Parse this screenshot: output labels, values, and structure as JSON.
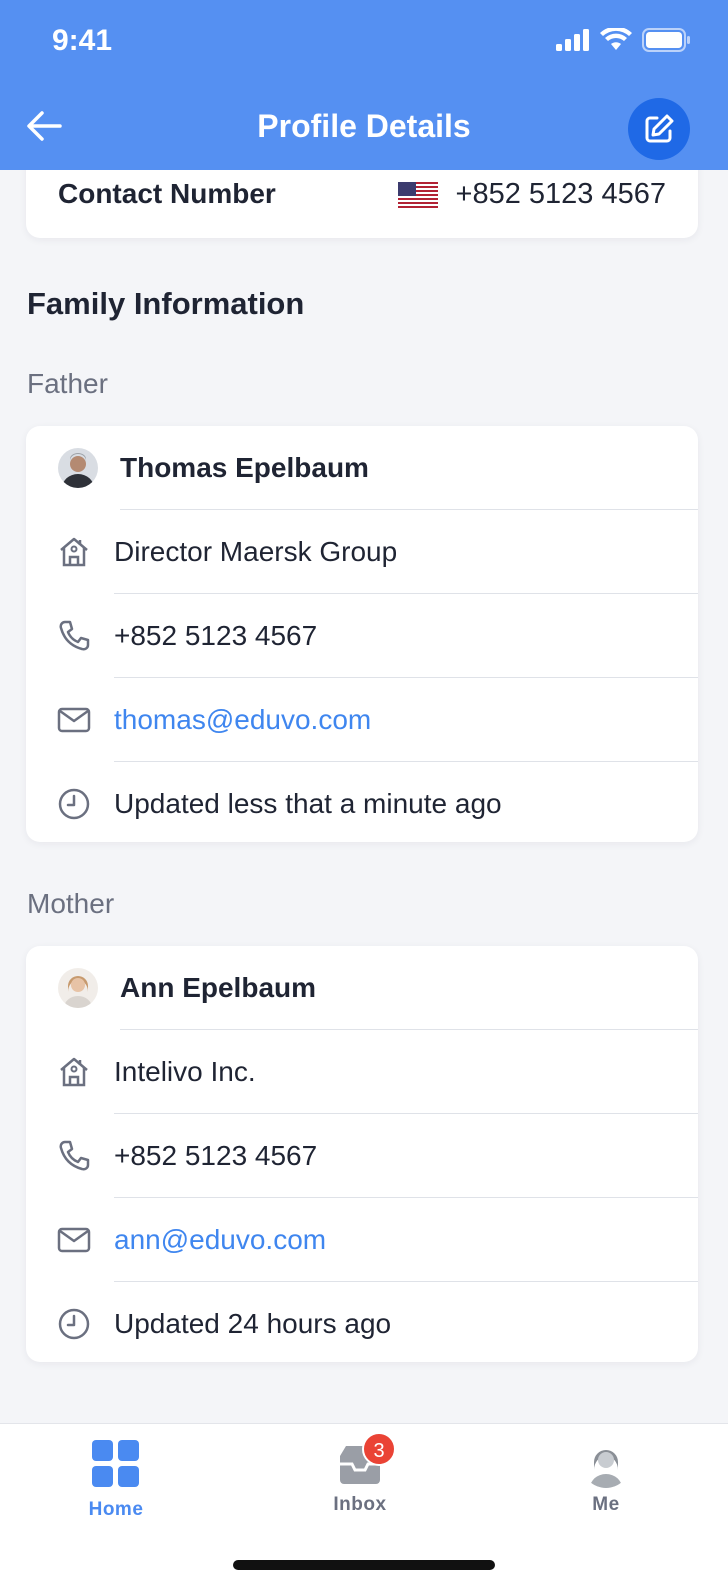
{
  "status": {
    "time": "9:41"
  },
  "header": {
    "title": "Profile Details"
  },
  "contact": {
    "label": "Contact Number",
    "value": "+852 5123 4567"
  },
  "family": {
    "title": "Family Information",
    "father": {
      "label": "Father",
      "name": "Thomas Epelbaum",
      "company": "Director Maersk Group",
      "phone": "+852 5123 4567",
      "email": "thomas@eduvo.com",
      "updated": "Updated less that a minute ago"
    },
    "mother": {
      "label": "Mother",
      "name": "Ann Epelbaum",
      "company": "Intelivo Inc.",
      "phone": "+852 5123 4567",
      "email": "ann@eduvo.com",
      "updated": "Updated 24 hours ago"
    }
  },
  "tabs": {
    "home": "Home",
    "inbox": "Inbox",
    "inbox_badge": "3",
    "me": "Me"
  },
  "colors": {
    "primary": "#5590f2",
    "primary_dark": "#1f69e6",
    "link": "#3f86ef",
    "badge": "#ea4335"
  }
}
